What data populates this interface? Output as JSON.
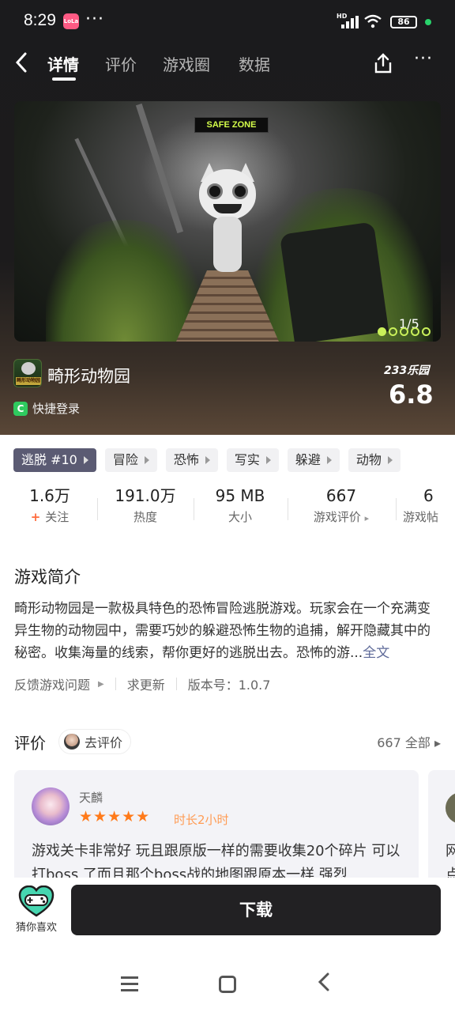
{
  "status_bar": {
    "time": "8:29",
    "app_badge": "LoLa",
    "dots": "···",
    "hd_label": "HD",
    "battery": "86"
  },
  "nav": {
    "back_icon": "‹",
    "tabs": [
      {
        "label": "详情",
        "active": true
      },
      {
        "label": "评价",
        "active": false
      },
      {
        "label": "游戏圈",
        "active": false
      },
      {
        "label": "数据",
        "active": false
      }
    ],
    "more_icon": "···"
  },
  "screenshot": {
    "sign_text": "SAFE ZONE",
    "counter": "1/5"
  },
  "game": {
    "title": "畸形动物园",
    "icon_text": "畸形动物园",
    "quick_login": "快捷登录",
    "quick_login_icon": "C",
    "score_brand": "233乐园",
    "score": "6.8"
  },
  "tags": [
    {
      "label": "逃脱 #10",
      "primary": true
    },
    {
      "label": "冒险",
      "primary": false
    },
    {
      "label": "恐怖",
      "primary": false
    },
    {
      "label": "写实",
      "primary": false
    },
    {
      "label": "躲避",
      "primary": false
    },
    {
      "label": "动物",
      "primary": false
    }
  ],
  "stats": [
    {
      "value": "1.6万",
      "label": "关注"
    },
    {
      "value": "191.0万",
      "label": "热度"
    },
    {
      "value": "95 MB",
      "label": "大小"
    },
    {
      "value": "667",
      "label": "游戏评价"
    },
    {
      "value": "6",
      "label": "游戏帖"
    }
  ],
  "stats_follow_plus": "+",
  "stats_reviews_arrow": "▸",
  "intro": {
    "title": "游戏简介",
    "text": "畸形动物园是一款极具特色的恐怖冒险逃脱游戏。玩家会在一个充满变异生物的动物园中，需要巧妙的躲避恐怖生物的追捕，解开隐藏其中的秘密。收集海量的线索，帮你更好的逃脱出去。恐怖的游...",
    "more": "全文",
    "feedback": "反馈游戏问题",
    "feedback_arrow": "▶",
    "request_update": "求更新",
    "version": "版本号：1.0.7"
  },
  "reviews": {
    "title": "评价",
    "go_review": "去评价",
    "all": "667 全部 ▸",
    "items": [
      {
        "name": "天麟",
        "stars": "★★★★★",
        "duration": "时长2小时",
        "text": "游戏关卡非常好 玩且跟原版一样的需要收集20个碎片 可以打boss 了而且那个boss战的地图跟原本一样 强烈"
      }
    ],
    "second_card_text": "网\n点"
  },
  "bottom": {
    "guess_label": "猜你喜欢",
    "download": "下载"
  },
  "colors": {
    "accent_tag": "#5b5b73",
    "star": "#ff7a1a",
    "download_bg": "#222123",
    "link": "#5f6b99"
  }
}
